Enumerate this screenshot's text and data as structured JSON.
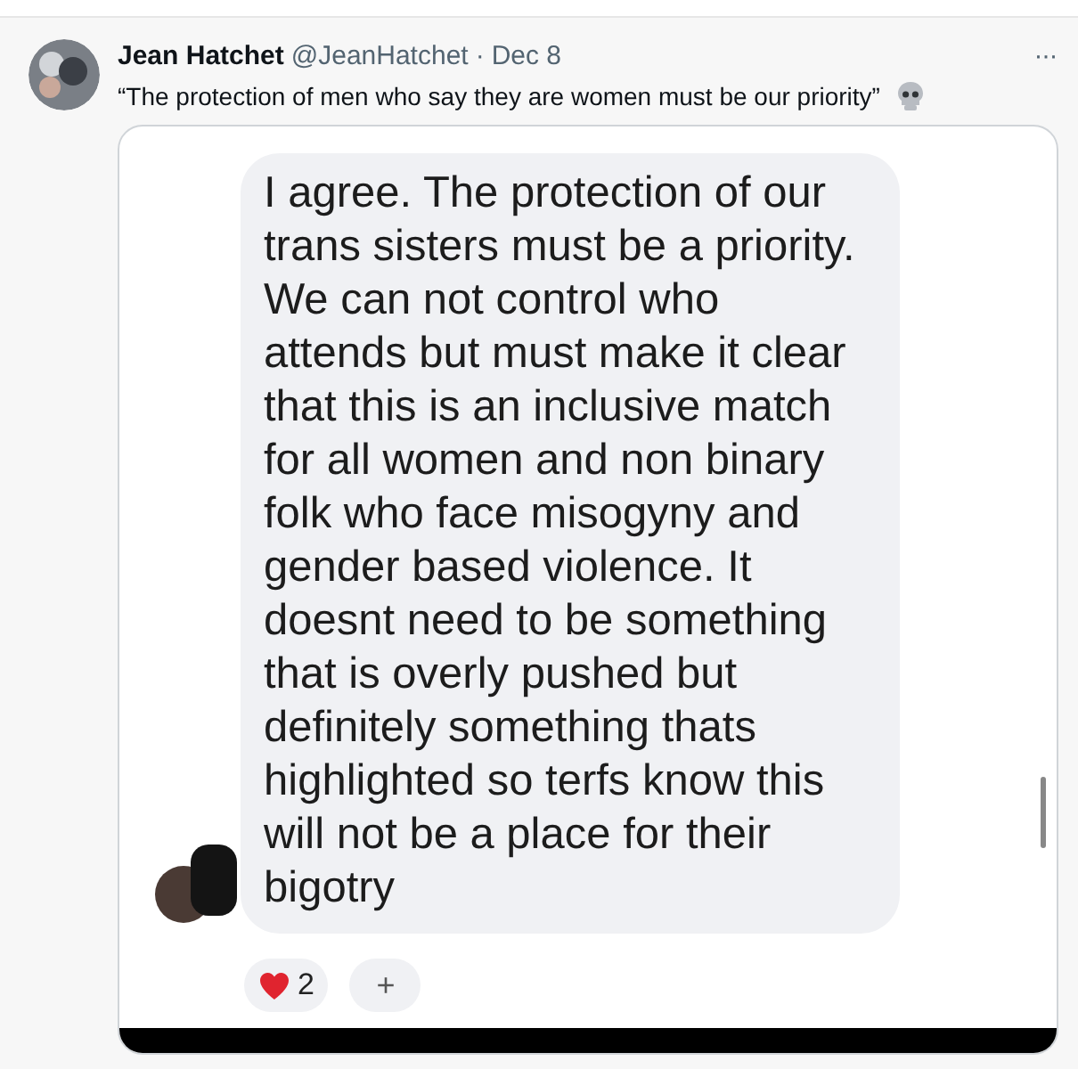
{
  "tweet": {
    "author": "Jean Hatchet",
    "handle": "@JeanHatchet",
    "separator": "·",
    "date": "Dec 8",
    "text": "“The protection of men who say they are women must be our priority”",
    "more": "···"
  },
  "media": {
    "message": {
      "text": "I agree. The protection of our trans sisters must be a priority. We can not control who attends but must make it clear that this is an inclusive match for all women and non binary folk who face misogyny and gender based violence. It doesnt need to be something that is overly pushed but definitely something thats highlighted so terfs know this will not be a place for their bigotry"
    },
    "reactions": [
      {
        "kind": "heart",
        "count": "2"
      }
    ],
    "add_reaction": "+"
  }
}
